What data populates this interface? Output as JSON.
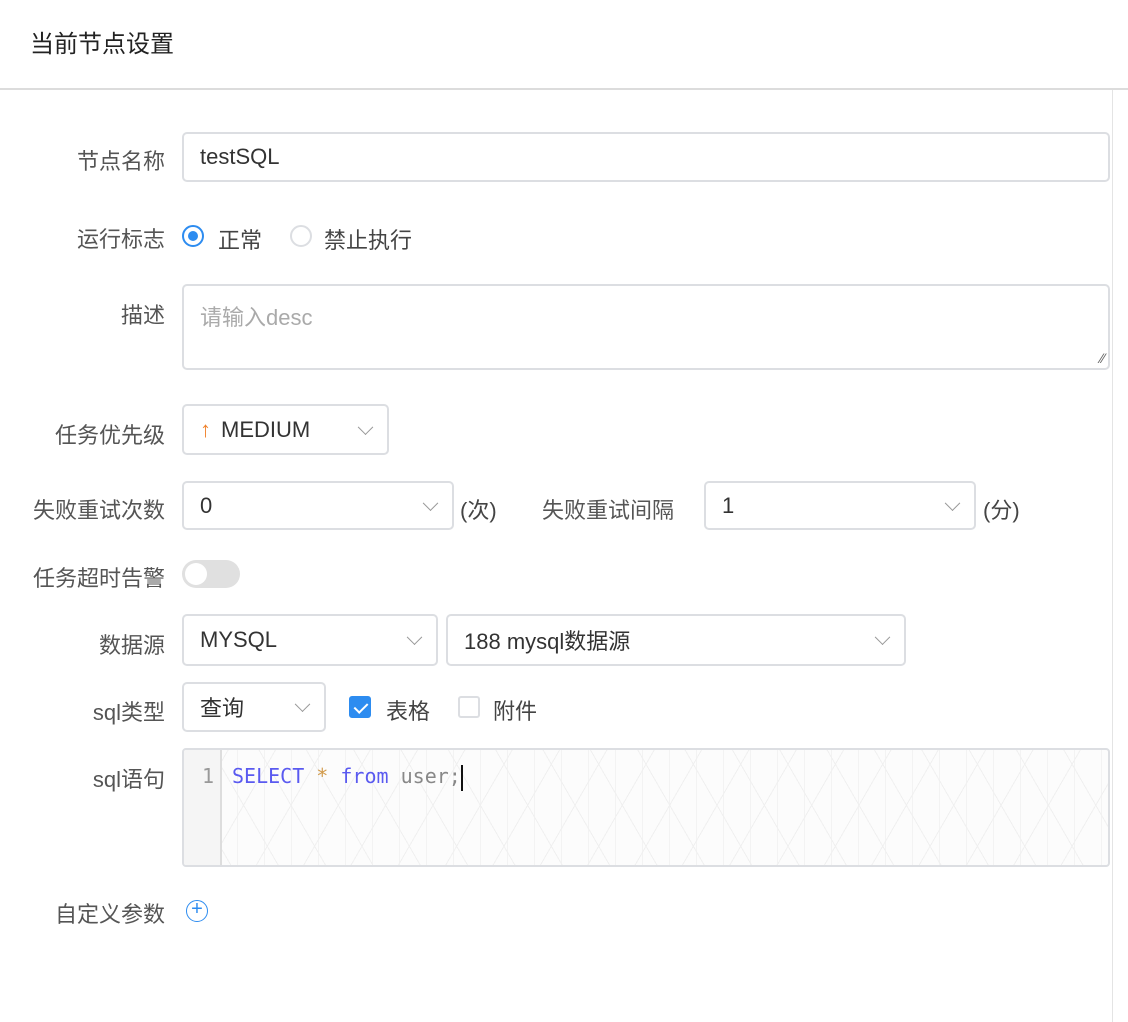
{
  "header": {
    "title": "当前节点设置"
  },
  "form": {
    "node_name": {
      "label": "节点名称",
      "value": "testSQL"
    },
    "run_flag": {
      "label": "运行标志",
      "options": [
        {
          "label": "正常",
          "selected": true
        },
        {
          "label": "禁止执行",
          "selected": false
        }
      ]
    },
    "desc": {
      "label": "描述",
      "placeholder": "请输入desc"
    },
    "priority": {
      "label": "任务优先级",
      "value": "MEDIUM",
      "icon": "arrow-up-icon",
      "icon_color": "#f0812a"
    },
    "retry_times": {
      "label": "失败重试次数",
      "value": "0",
      "unit": "(次)"
    },
    "retry_interval": {
      "label": "失败重试间隔",
      "value": "1",
      "unit": "(分)"
    },
    "timeout_alarm": {
      "label": "任务超时告警",
      "enabled": false
    },
    "datasource": {
      "label": "数据源",
      "type": "MYSQL",
      "source": "188 mysql数据源"
    },
    "sql_type": {
      "label": "sql类型",
      "value": "查询",
      "checkboxes": [
        {
          "label": "表格",
          "checked": true
        },
        {
          "label": "附件",
          "checked": false
        }
      ]
    },
    "sql": {
      "label": "sql语句",
      "line_number": "1",
      "tokens": {
        "keyword1": "SELECT",
        "op": "*",
        "keyword2": "from",
        "ident": "user;"
      }
    },
    "custom_params": {
      "label": "自定义参数"
    }
  },
  "colors": {
    "accent": "#2d8cf0"
  }
}
